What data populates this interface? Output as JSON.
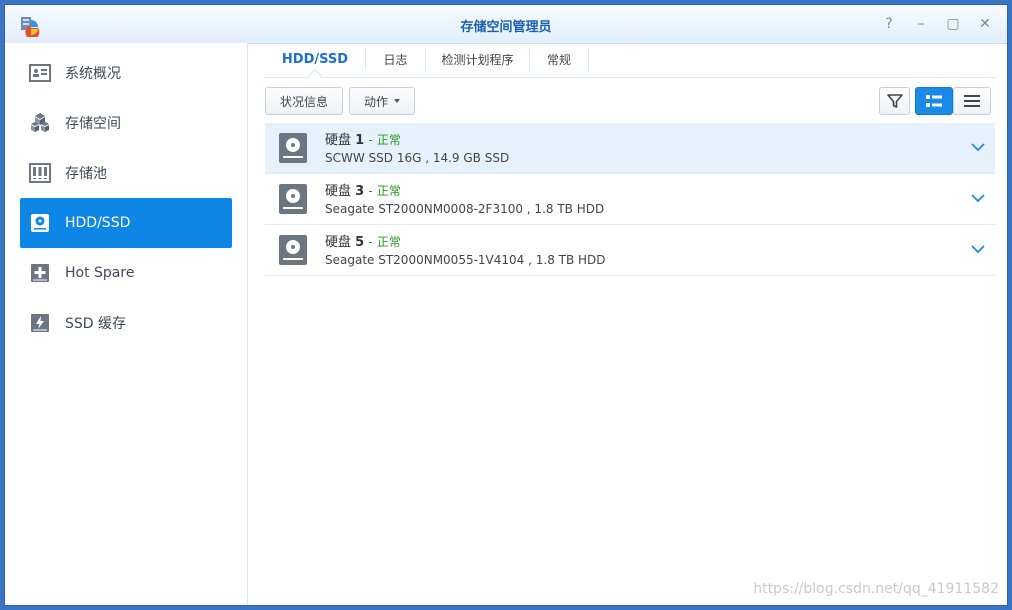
{
  "window": {
    "title": "存储空间管理员",
    "controls": [
      "?",
      "–",
      "▢",
      "✕"
    ]
  },
  "sidebar": {
    "items": [
      {
        "label": "系统概况",
        "icon": "overview-icon"
      },
      {
        "label": "存储空间",
        "icon": "cubes-icon"
      },
      {
        "label": "存储池",
        "icon": "storage-pool-icon"
      },
      {
        "label": "HDD/SSD",
        "icon": "disk-icon",
        "active": true
      },
      {
        "label": "Hot Spare",
        "icon": "plus-box-icon"
      },
      {
        "label": "SSD 缓存",
        "icon": "lightning-icon"
      }
    ]
  },
  "tabs": [
    {
      "label": "HDD/SSD",
      "active": true
    },
    {
      "label": "日志"
    },
    {
      "label": "检测计划程序"
    },
    {
      "label": "常规"
    }
  ],
  "toolbar": {
    "status_label": "状况信息",
    "action_label": "动作"
  },
  "disks": [
    {
      "title": "硬盘",
      "number": "1",
      "status": "正常",
      "desc": "SCWW SSD 16G , 14.9 GB SSD",
      "selected": true
    },
    {
      "title": "硬盘",
      "number": "3",
      "status": "正常",
      "desc": "Seagate ST2000NM0008-2F3100 , 1.8 TB HDD"
    },
    {
      "title": "硬盘",
      "number": "5",
      "status": "正常",
      "desc": "Seagate ST2000NM0055-1V4104 , 1.8 TB HDD"
    }
  ],
  "watermark": "https://blog.csdn.net/qq_41911582",
  "colors": {
    "accent": "#0d86e6",
    "status_ok": "#2a9a22"
  }
}
